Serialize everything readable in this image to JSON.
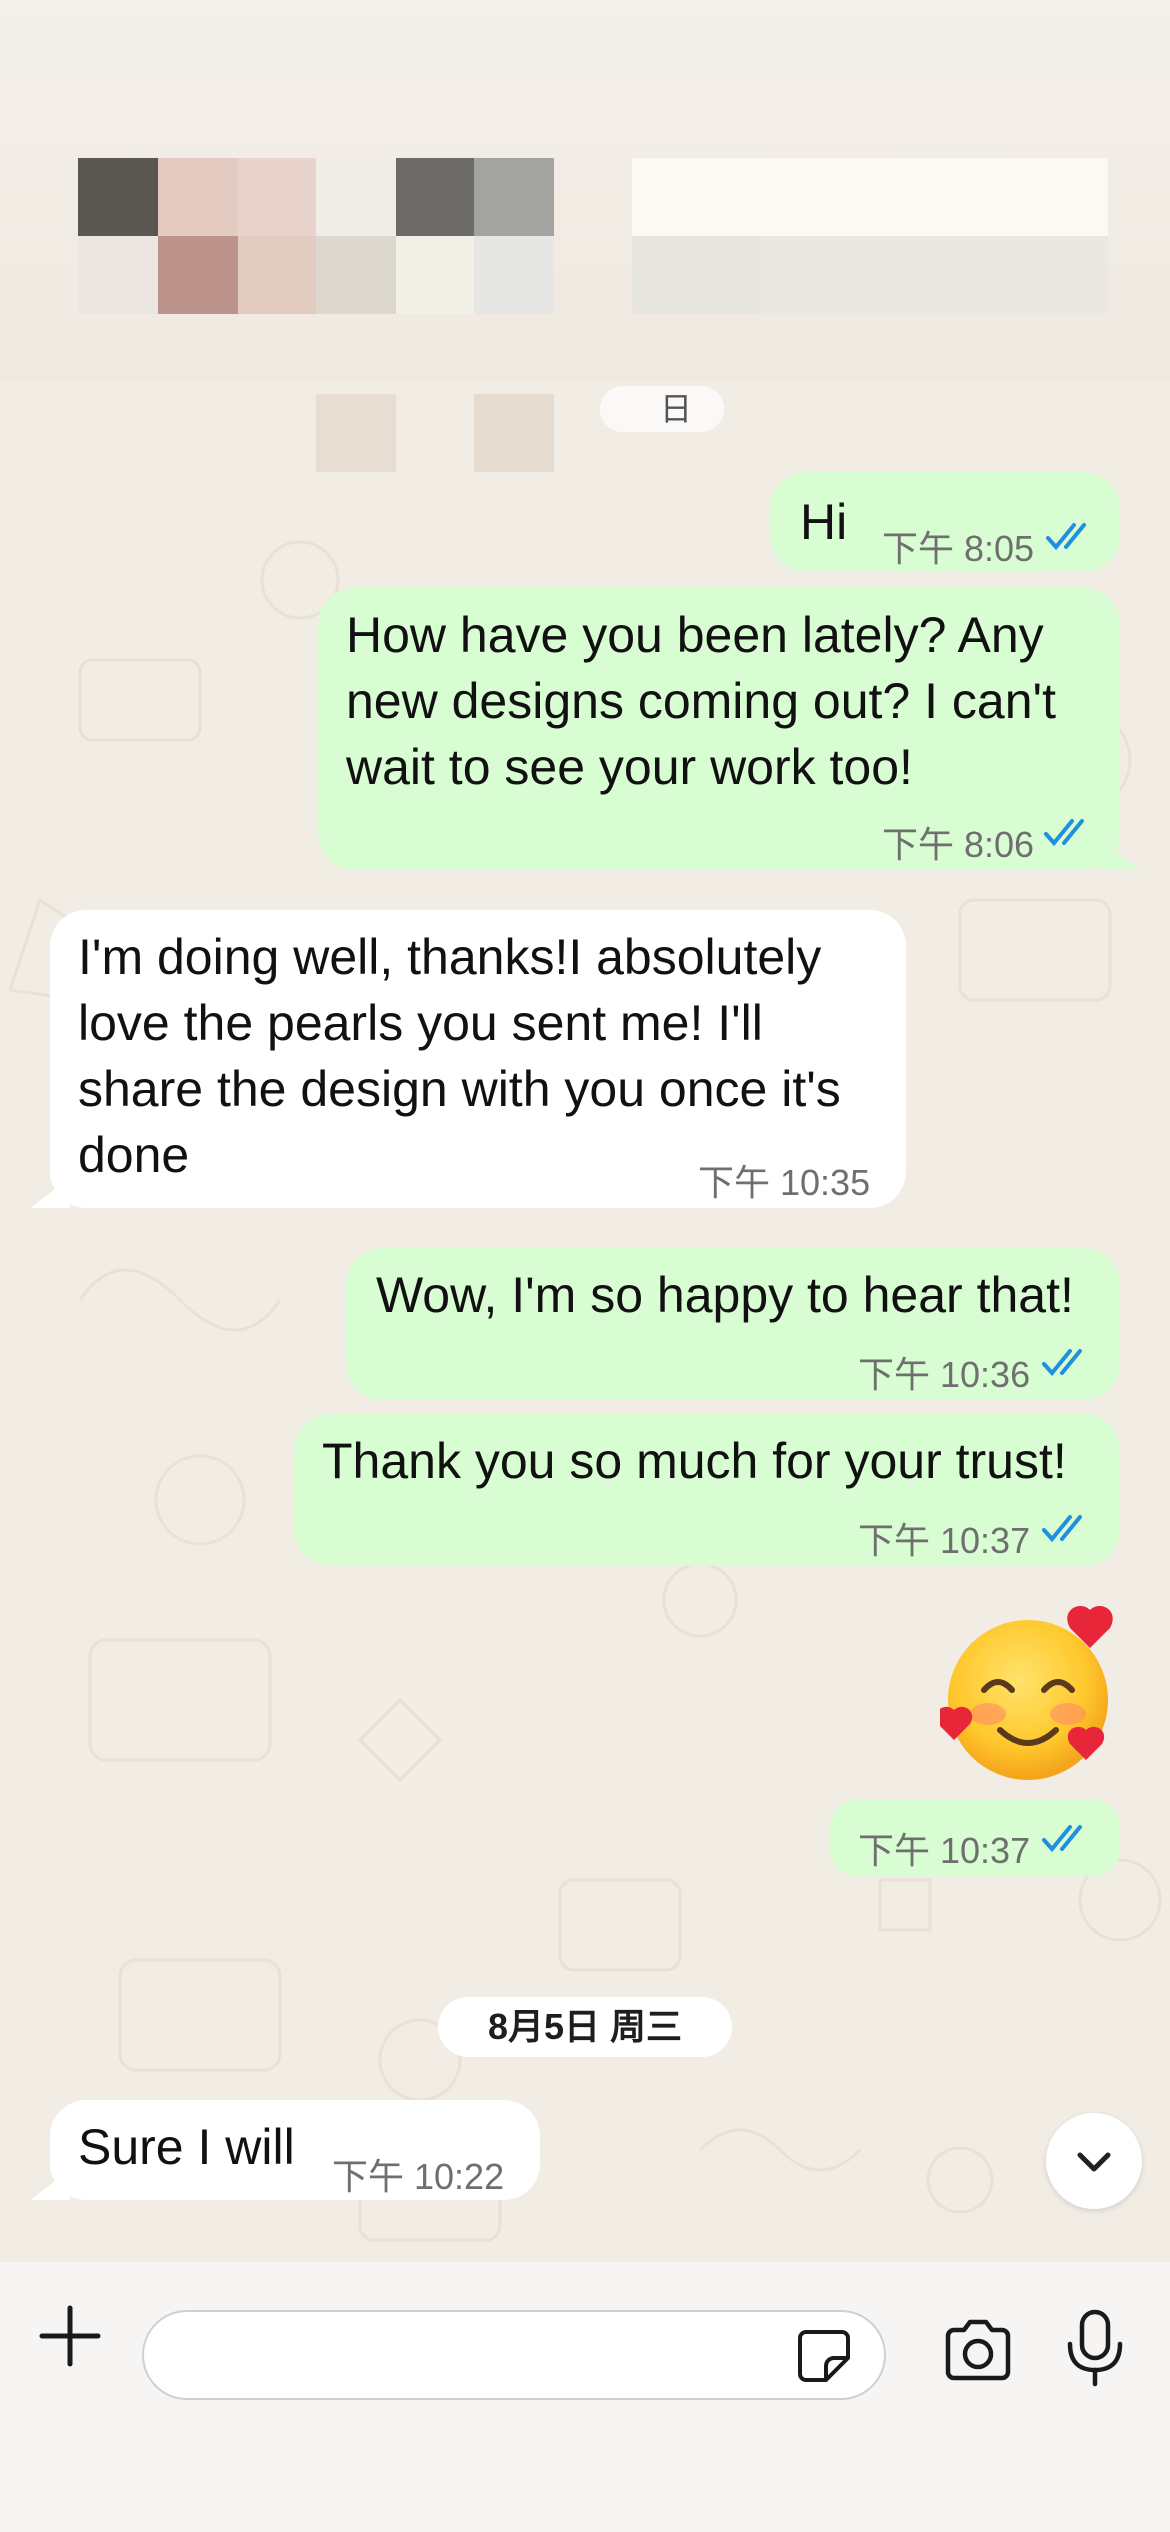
{
  "header": {
    "redacted": true
  },
  "date_separator_top": {
    "label_fragment": "日"
  },
  "messages": [
    {
      "direction": "out",
      "text": "Hi",
      "time": "下午 8:05",
      "status": "read"
    },
    {
      "direction": "out",
      "lines": [
        "How have you been lately? Any",
        "new designs coming out? I can't",
        "wait to see your work too!"
      ],
      "time": "下午 8:06",
      "status": "read"
    },
    {
      "direction": "in",
      "lines": [
        "I'm doing well, thanks!I absolutely",
        "love the pearls you sent me! I'll",
        "share the design with you once it's",
        "done"
      ],
      "time": "下午 10:35"
    },
    {
      "direction": "out",
      "text": "Wow, I'm so happy to hear that!",
      "time": "下午 10:36",
      "status": "read"
    },
    {
      "direction": "out",
      "text": "Thank you so much for your trust!",
      "time": "下午 10:37",
      "status": "read"
    },
    {
      "direction": "out",
      "type": "emoji",
      "emoji_name": "smiling-face-with-hearts",
      "time": "下午 10:37",
      "status": "read"
    },
    {
      "direction": "in",
      "text": "Sure I will",
      "time": "下午 10:22"
    }
  ],
  "date_separator": {
    "label": "8月5日 周三"
  },
  "input_bar": {
    "placeholder": "",
    "icons": [
      "plus-icon",
      "sticker-icon",
      "camera-icon",
      "microphone-icon"
    ]
  },
  "colors": {
    "outgoing_bubble": "#d9fdd3",
    "incoming_bubble": "#ffffff",
    "read_ticks": "#1f8fe0",
    "background": "#f1ece4"
  }
}
